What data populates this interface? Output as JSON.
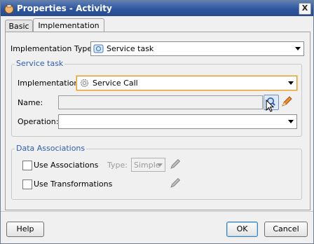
{
  "window": {
    "title": "Properties - Activity",
    "close_label": "X"
  },
  "tabs": [
    {
      "label": "Basic"
    },
    {
      "label": "Implementation"
    }
  ],
  "implementation_type": {
    "label": "Implementation Type:",
    "value": "Service task"
  },
  "service_task": {
    "legend": "Service task",
    "implementation_label": "Implementation:",
    "implementation_value": "Service Call",
    "name_label": "Name:",
    "name_value": "",
    "operation_label": "Operation:",
    "operation_value": ""
  },
  "data_associations": {
    "legend": "Data Associations",
    "use_associations_label": "Use Associations",
    "type_label": "Type:",
    "type_value": "Simple",
    "use_transformations_label": "Use Transformations"
  },
  "buttons": {
    "help": "Help",
    "ok": "OK",
    "cancel": "Cancel"
  }
}
